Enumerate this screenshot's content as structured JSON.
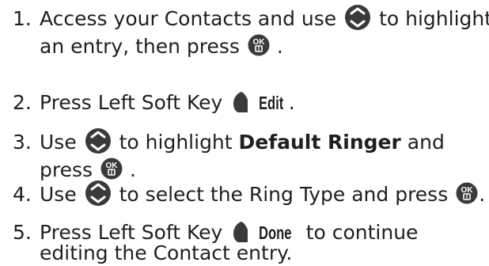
{
  "steps": [
    {
      "number": "1.",
      "line1_a": "Access your Contacts and use",
      "line1_icon": "nav-key-icon",
      "line1_b": "to highlight",
      "line2_a": "an entry, then press",
      "line2_icon": "ok-key-icon",
      "line2_b": "."
    },
    {
      "number": "2.",
      "a": "Press Left Soft Key",
      "icon": "left-soft-key-icon",
      "key_label": "Edit",
      "b": "."
    },
    {
      "number": "3.",
      "line1_a": "Use",
      "line1_icon": "nav-key-icon",
      "line1_b": "to highlight",
      "line1_bold": "Default Ringer",
      "line1_c": "and",
      "line2_a": "press",
      "line2_icon": "ok-key-icon",
      "line2_b": "."
    },
    {
      "number": "4.",
      "a": "Use",
      "icon1": "nav-key-icon",
      "b": "to select the Ring Type and press",
      "icon2": "ok-key-icon",
      "c": "."
    },
    {
      "number": "5.",
      "line1_a": "Press Left Soft Key",
      "line1_icon": "left-soft-key-icon",
      "line1_key_label": "Done",
      "line1_b": "to continue",
      "line2": "editing the Contact entry."
    }
  ],
  "icon_colors": {
    "key_body": "#3a3a3a",
    "key_symbol": "#ffffff"
  }
}
